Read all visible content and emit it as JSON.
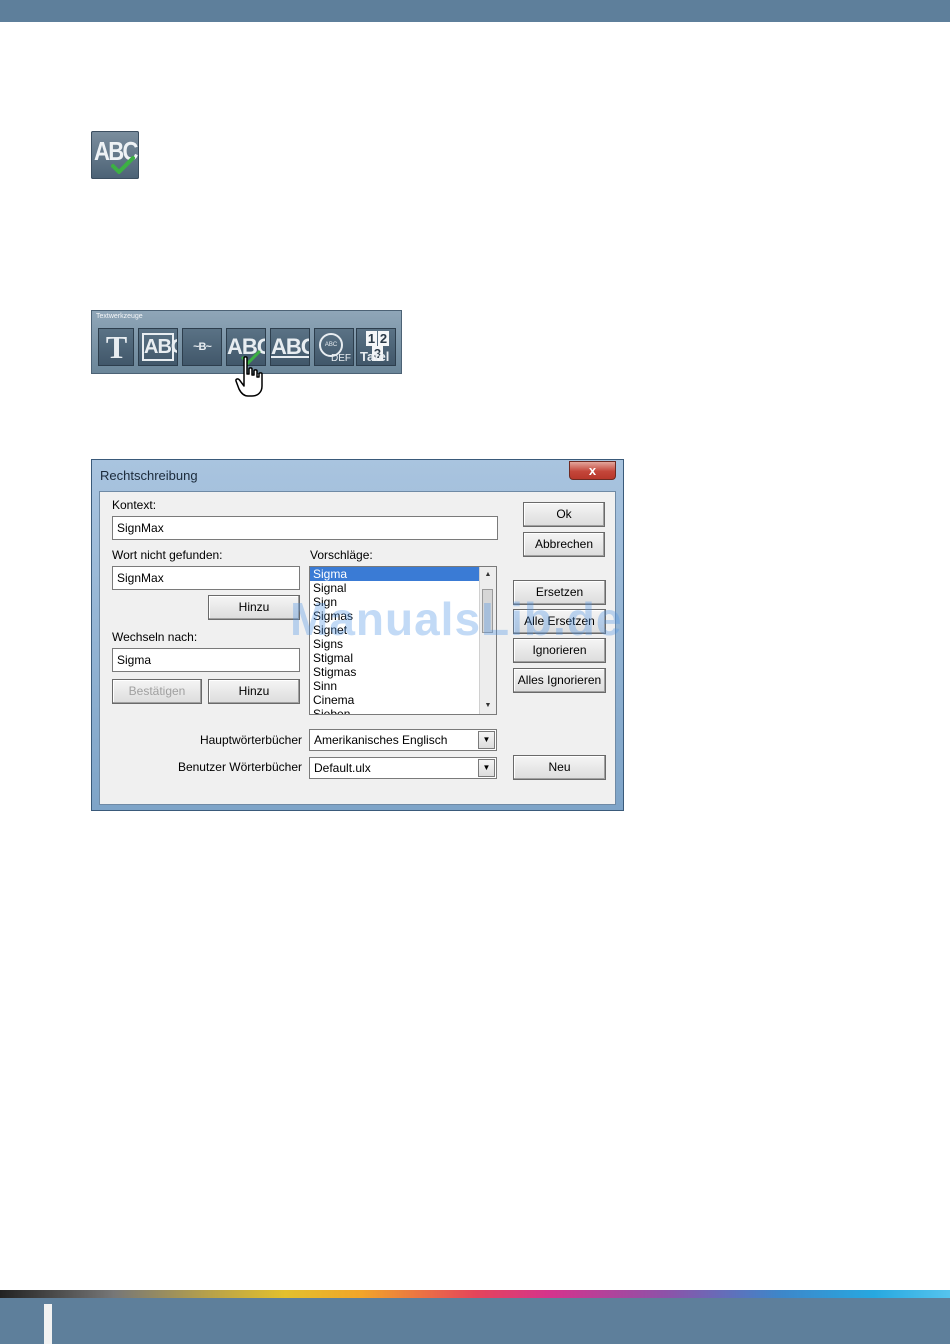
{
  "toolbar": {
    "title": "Textwerkzeuge",
    "buttons": [
      {
        "icon": "text-tool-icon",
        "label": "T"
      },
      {
        "icon": "abc-box-icon",
        "label": "ABC"
      },
      {
        "icon": "text-on-path-icon",
        "label": "~B~"
      },
      {
        "icon": "spellcheck-icon",
        "label": "ABC"
      },
      {
        "icon": "abc-underline-icon",
        "label": "ABC"
      },
      {
        "icon": "abc-definition-icon",
        "label": "DEF",
        "circle": "ABC"
      },
      {
        "icon": "number-table-icon",
        "numbers": [
          "1",
          "2",
          "3"
        ],
        "label": "Tafel"
      }
    ]
  },
  "big_icon": {
    "label": "ABC",
    "icon": "spellcheck-icon",
    "check_color": "#3cb043"
  },
  "dialog": {
    "title": "Rechtschreibung",
    "close_label": "x",
    "context_label": "Kontext:",
    "context_value": "SignMax",
    "not_found_label": "Wort nicht gefunden:",
    "not_found_value": "SignMax",
    "add_label": "Hinzu",
    "change_to_label": "Wechseln nach:",
    "change_to_value": "Sigma",
    "confirm_label": "Bestätigen",
    "add2_label": "Hinzu",
    "suggestions_label": "Vorschläge:",
    "suggestions": [
      "Sigma",
      "Signal",
      "Sign",
      "Sigmas",
      "Signet",
      "Signs",
      "Stigmal",
      "Stigmas",
      "Sinn",
      "Cinema",
      "Sieben"
    ],
    "selected_index": 0,
    "ok_label": "Ok",
    "cancel_label": "Abbrechen",
    "replace_label": "Ersetzen",
    "replace_all_label": "Alle Ersetzen",
    "ignore_label": "Ignorieren",
    "ignore_all_label": "Alles Ignorieren",
    "main_dict_label": "Hauptwörterbücher",
    "main_dict_value": "Amerikanisches Englisch",
    "user_dict_label": "Benutzer Wörterbücher",
    "user_dict_value": "Default.ulx",
    "new_label": "Neu"
  },
  "watermark": "ManualsLib.de",
  "colors": {
    "bar": "#5e7f9b",
    "selection": "#3a7bd5",
    "check": "#3cb043"
  }
}
